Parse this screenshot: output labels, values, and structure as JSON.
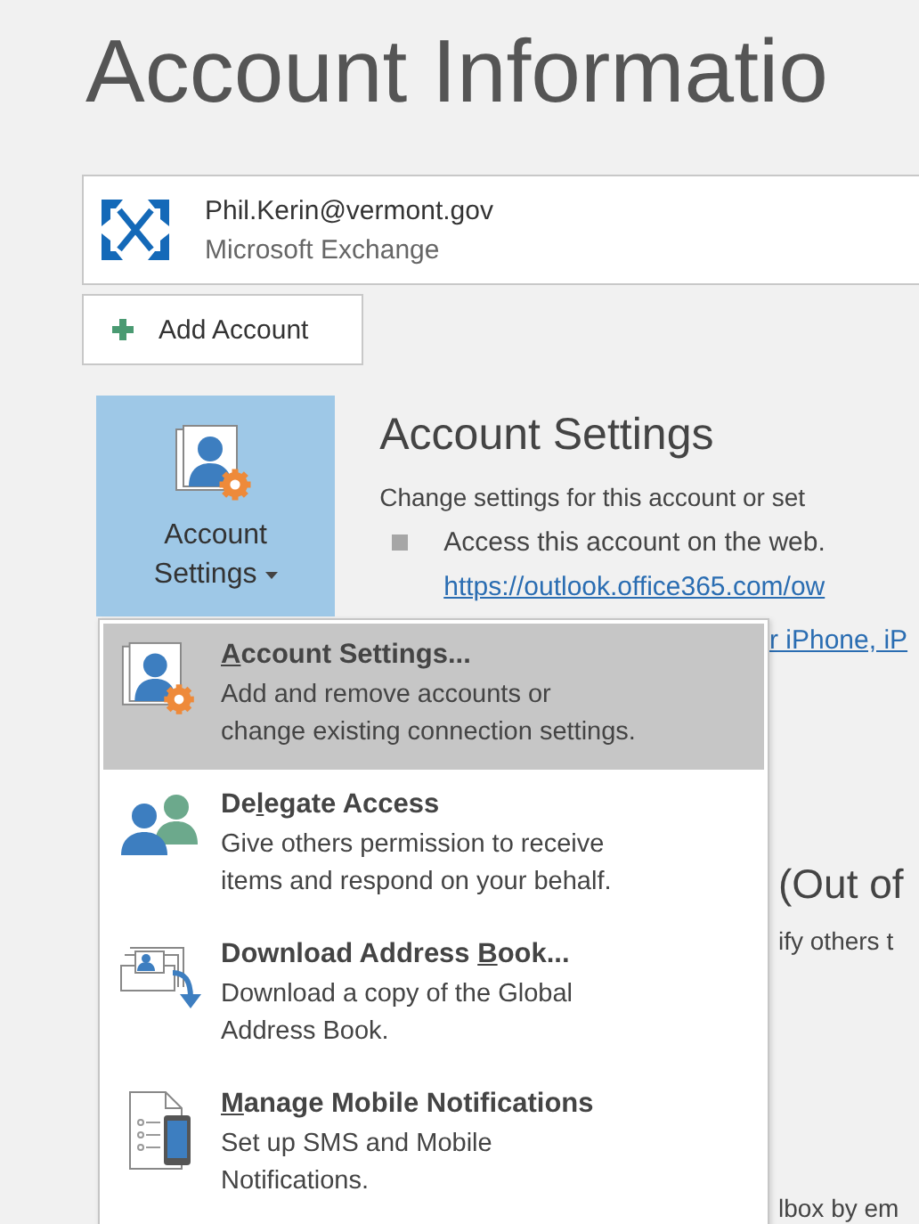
{
  "title": "Account Informatio",
  "account": {
    "email": "Phil.Kerin@vermont.gov",
    "type": "Microsoft Exchange"
  },
  "add_account_button": {
    "label": "Add Account"
  },
  "account_settings_button": {
    "label": "Account Settings",
    "expanded": true
  },
  "section": {
    "heading": "Account Settings",
    "description": "Change settings for this account or set",
    "bullet": "Access this account on the web.",
    "link": "https://outlook.office365.com/ow",
    "link_fragment": "r iPhone, iP"
  },
  "section_2": {
    "heading": "(Out of",
    "description": "ify others t"
  },
  "section_3": {
    "text": "lbox by em"
  },
  "menu": {
    "items": [
      {
        "kind": "account-settings",
        "label": [
          {
            "text": "A",
            "underlined": true
          },
          {
            "text": "ccount Settings...",
            "underlined": false
          }
        ],
        "description_lines": [
          "Add and remove accounts or",
          "change existing connection settings."
        ],
        "selected": true
      },
      {
        "kind": "delegate",
        "label": [
          {
            "text": "De",
            "underlined": false
          },
          {
            "text": "l",
            "underlined": true
          },
          {
            "text": "egate Access",
            "underlined": false
          }
        ],
        "description_lines": [
          "Give others permission to receive",
          "items and respond on your behalf."
        ],
        "selected": false
      },
      {
        "kind": "address-book",
        "label": [
          {
            "text": "Download Address ",
            "underlined": false
          },
          {
            "text": "B",
            "underlined": true
          },
          {
            "text": "ook...",
            "underlined": false
          }
        ],
        "description_lines": [
          "Download a copy of the Global",
          "Address Book."
        ],
        "selected": false
      },
      {
        "kind": "mobile",
        "label": [
          {
            "text": "M",
            "underlined": true
          },
          {
            "text": "anage Mobile Notifications",
            "underlined": false
          }
        ],
        "description_lines": [
          "Set up SMS and Mobile",
          "Notifications."
        ],
        "selected": false
      }
    ]
  }
}
